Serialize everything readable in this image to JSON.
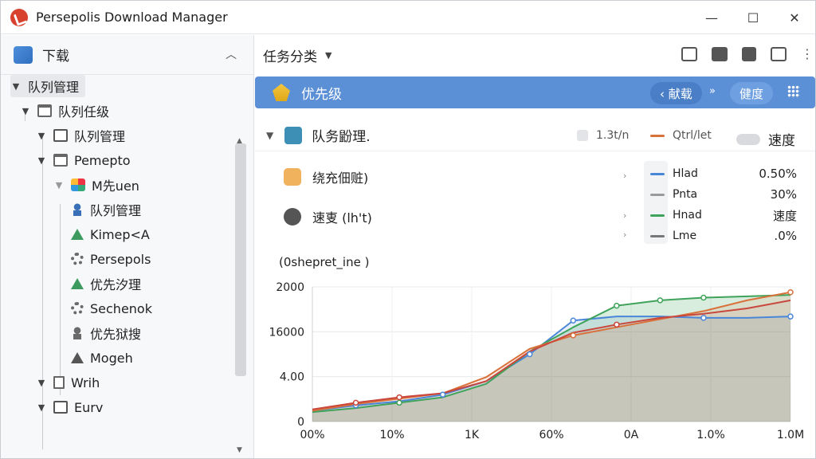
{
  "window": {
    "title": "Persepolis Download Manager",
    "controls": {
      "minimize": "—",
      "maximize": "☐",
      "close": "✕"
    }
  },
  "sidebar": {
    "header": "下载",
    "tree": [
      {
        "label": "队列管理",
        "level": 0,
        "icon": "chevron-down-icon",
        "selected": true
      },
      {
        "label": "队列任级",
        "level": 1,
        "icon": "folder-icon"
      },
      {
        "label": "队列管理",
        "level": 2,
        "icon": "folder-icon"
      },
      {
        "label": "Pemepto",
        "level": 2,
        "icon": "window-icon"
      },
      {
        "label": "M先uen",
        "level": 3,
        "icon": "multi-color-icon"
      },
      {
        "label": "队列管理",
        "level": 3,
        "icon": "person-icon"
      },
      {
        "label": "Kimep<A",
        "level": 3,
        "icon": "home-green-icon"
      },
      {
        "label": "Persepols",
        "level": 3,
        "icon": "gear-icon"
      },
      {
        "label": "优先汐理",
        "level": 3,
        "icon": "home-green-icon"
      },
      {
        "label": "Sechenok",
        "level": 3,
        "icon": "gear-icon"
      },
      {
        "label": "优先狱搜",
        "level": 3,
        "icon": "person-gray-icon"
      },
      {
        "label": "Mogeh",
        "level": 3,
        "icon": "home-gray-icon"
      },
      {
        "label": "Wrih",
        "level": 2,
        "icon": "document-icon"
      },
      {
        "label": "Eurv",
        "level": 2,
        "icon": "folder-icon"
      }
    ]
  },
  "toolbar": {
    "category_label": "任务分类"
  },
  "banner": {
    "label": "优先级",
    "pill_one": "‹ 献载",
    "arrow": "»",
    "pill_two": "健度"
  },
  "section": {
    "label": "队务鼢理.",
    "meta_one": "1.3t/n",
    "meta_two": "Qtrl/let",
    "meta_three": "速度"
  },
  "attributes": [
    {
      "label": "绕充佃赃)",
      "icon": "shield-icon"
    },
    {
      "label": "速叓 (lh't)",
      "icon": "gauge-icon"
    }
  ],
  "legend": [
    {
      "name": "Hlad",
      "value": "0.50%",
      "color": "#4a86d8"
    },
    {
      "name": "Pnta",
      "value": "30%",
      "color": "#9a9a9a"
    },
    {
      "name": "Hnad",
      "value": "速度",
      "color": "#3fa35b"
    },
    {
      "name": "Lme",
      "value": ".0%",
      "color": "#777777"
    }
  ],
  "colors": {
    "blue": "#4a86d8",
    "green": "#3fa35b",
    "orange": "#d9713a",
    "red": "#c9473c",
    "banner": "#5b8fd6"
  },
  "chart_data": {
    "type": "line",
    "title": "(0shepret_ine )",
    "y_tick_labels": [
      "0",
      "4.00",
      "16000",
      "2000"
    ],
    "x_tick_labels": [
      "00%",
      "10%",
      "1K",
      "60%",
      "0A",
      "1.0%",
      "1.0M"
    ],
    "x": [
      0,
      1,
      2,
      3,
      4,
      5,
      6,
      7,
      8,
      9,
      10,
      11
    ],
    "ylim": [
      0,
      100
    ],
    "series": [
      {
        "color": "#4a86d8",
        "values": [
          8,
          12,
          15,
          20,
          30,
          50,
          75,
          78,
          78,
          77,
          77,
          78
        ]
      },
      {
        "color": "#3fa35b",
        "values": [
          7,
          10,
          14,
          18,
          28,
          52,
          70,
          86,
          90,
          92,
          93,
          94
        ]
      },
      {
        "color": "#d9713a",
        "values": [
          8,
          13,
          17,
          21,
          33,
          54,
          64,
          70,
          76,
          82,
          90,
          96
        ]
      },
      {
        "color": "#c9473c",
        "values": [
          9,
          14,
          18,
          21,
          30,
          52,
          66,
          72,
          77,
          80,
          84,
          90
        ]
      }
    ],
    "markers": {
      "blue": [
        1,
        3,
        5,
        6,
        9,
        11
      ],
      "green": [
        2,
        7,
        8,
        9
      ],
      "orange": [
        6,
        11
      ],
      "red": [
        1,
        2,
        7
      ]
    },
    "grid": true,
    "area_fill": true
  }
}
